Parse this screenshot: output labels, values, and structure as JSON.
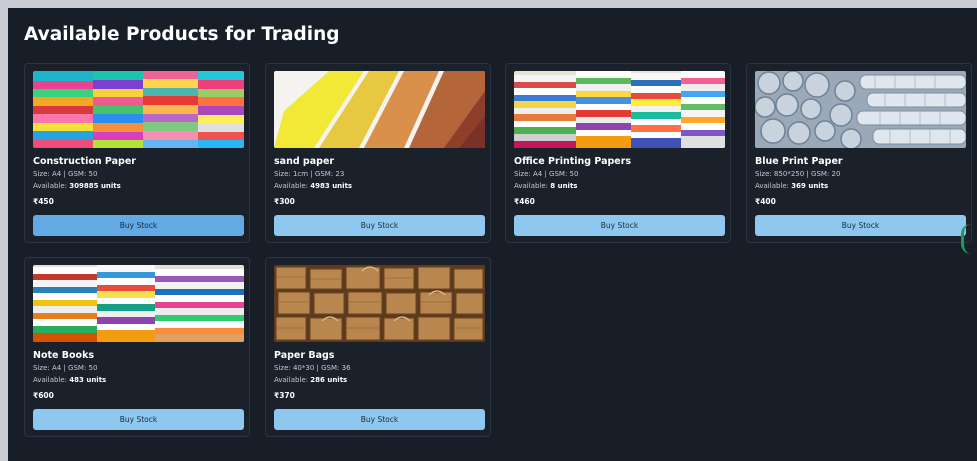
{
  "page": {
    "title": "Available Products for Trading"
  },
  "products": [
    {
      "name": "Construction Paper",
      "size_label": "Size:",
      "size": "A4",
      "gsm_label": "GSM:",
      "gsm": "50",
      "available_label": "Available:",
      "available": "309885 units",
      "price": "₹450",
      "button": "Buy Stock",
      "image": "colorful-construction-paper-stacks"
    },
    {
      "name": "sand paper",
      "size_label": "Size:",
      "size": "1cm",
      "gsm_label": "GSM:",
      "gsm": "23",
      "available_label": "Available:",
      "available": "4983 units",
      "price": "₹300",
      "button": "Buy Stock",
      "image": "sand-paper-sheets"
    },
    {
      "name": "Office Printing Papers",
      "size_label": "Size:",
      "size": "A4",
      "gsm_label": "GSM:",
      "gsm": "50",
      "available_label": "Available:",
      "available": "8 units",
      "price": "₹460",
      "button": "Buy Stock",
      "image": "office-paper-stacks"
    },
    {
      "name": "Blue Print Paper",
      "size_label": "Size:",
      "size": "850*250",
      "gsm_label": "GSM:",
      "gsm": "20",
      "available_label": "Available:",
      "available": "369 units",
      "price": "₹400",
      "button": "Buy Stock",
      "image": "blueprint-paper-rolls"
    },
    {
      "name": "Note Books",
      "size_label": "Size:",
      "size": "A4",
      "gsm_label": "GSM:",
      "gsm": "50",
      "available_label": "Available:",
      "available": "483 units",
      "price": "₹600",
      "button": "Buy Stock",
      "image": "notebook-stacks"
    },
    {
      "name": "Paper Bags",
      "size_label": "Size:",
      "size": "40*30",
      "gsm_label": "GSM:",
      "gsm": "36",
      "available_label": "Available:",
      "available": "286 units",
      "price": "₹370",
      "button": "Buy Stock",
      "image": "brown-paper-bags"
    }
  ],
  "colors": {
    "background": "#171e28",
    "card_border": "#2b3442",
    "button": "#8ec8ee",
    "button_active": "#63a9e4",
    "text": "#ffffff"
  }
}
